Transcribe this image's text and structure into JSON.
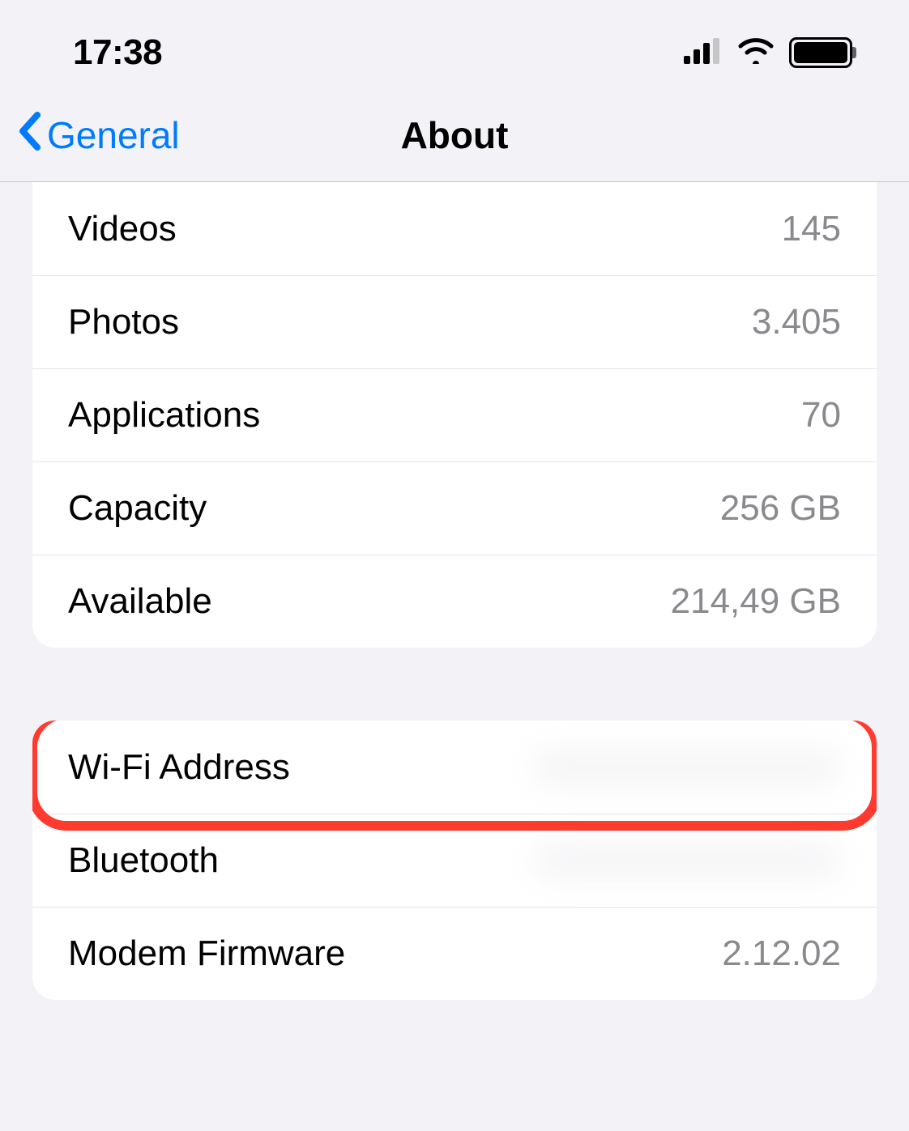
{
  "status": {
    "time": "17:38"
  },
  "nav": {
    "back_label": "General",
    "title": "About"
  },
  "rows": {
    "videos": {
      "label": "Videos",
      "value": "145"
    },
    "photos": {
      "label": "Photos",
      "value": "3.405"
    },
    "applications": {
      "label": "Applications",
      "value": "70"
    },
    "capacity": {
      "label": "Capacity",
      "value": "256 GB"
    },
    "available": {
      "label": "Available",
      "value": "214,49 GB"
    },
    "wifi": {
      "label": "Wi-Fi Address",
      "value": ""
    },
    "bluetooth": {
      "label": "Bluetooth",
      "value": ""
    },
    "modem": {
      "label": "Modem Firmware",
      "value": "2.12.02"
    }
  }
}
